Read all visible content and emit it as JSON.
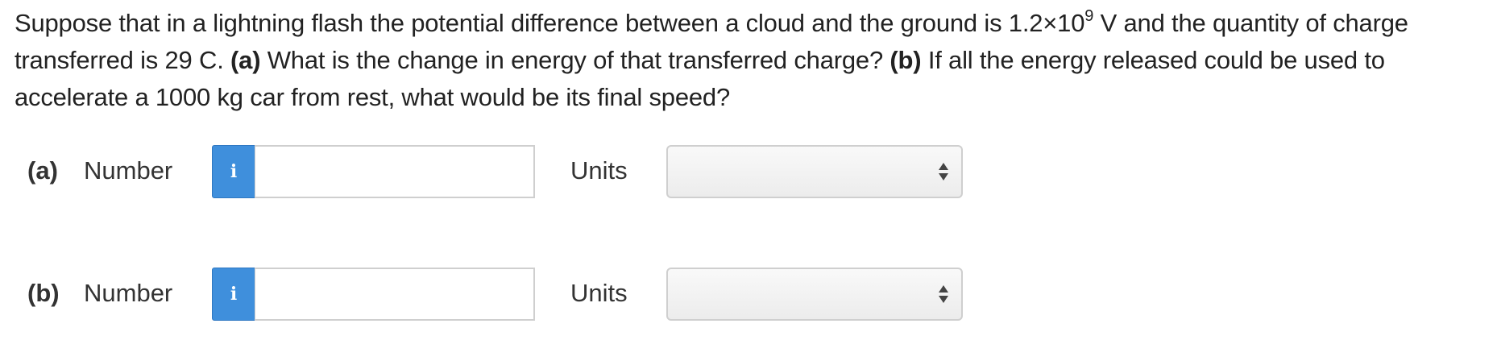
{
  "question": {
    "line1_before_exponent": "Suppose that in a lightning flash the potential difference between a cloud and the ground is 1.2×10",
    "exponent": "9",
    "line1_after_exponent": " V and the quantity of charge transferred is 29 C. ",
    "part_a_tag": "(a)",
    "part_a_text": " What is the change in energy of that transferred charge? ",
    "part_b_tag": "(b)",
    "part_b_text": " If all the energy released could be used to accelerate a 1000 kg car from rest, what would be its final speed?"
  },
  "answers": [
    {
      "part": "(a)",
      "number_label": "Number",
      "info_icon": "i",
      "number_value": "",
      "units_label": "Units",
      "units_selected": ""
    },
    {
      "part": "(b)",
      "number_label": "Number",
      "info_icon": "i",
      "number_value": "",
      "units_label": "Units",
      "units_selected": ""
    }
  ],
  "colors": {
    "info_button": "#3f8fdc",
    "text": "#222222",
    "border": "#cfcfcf"
  }
}
